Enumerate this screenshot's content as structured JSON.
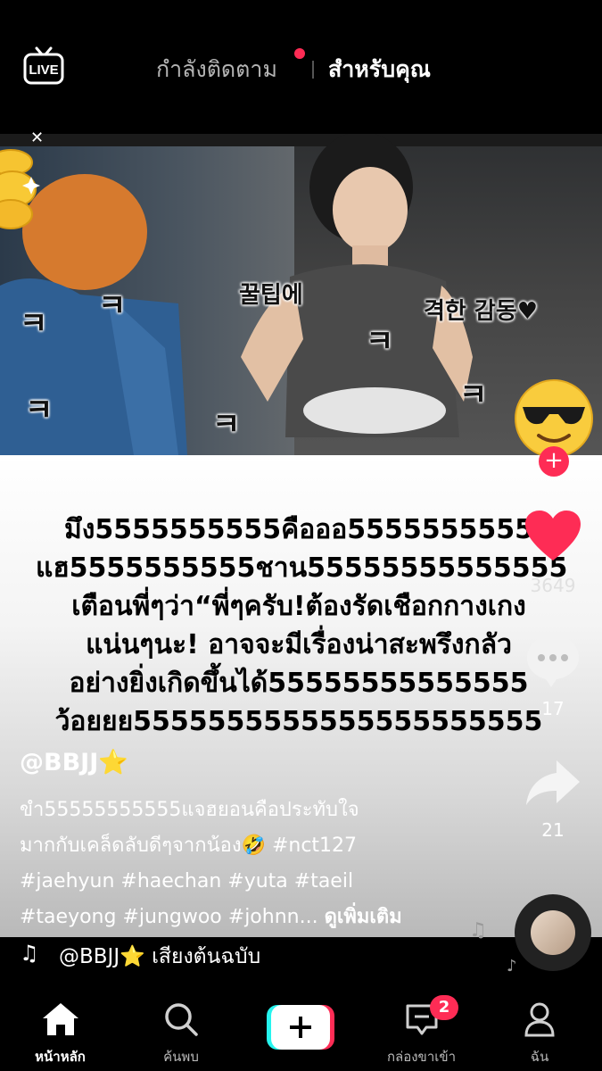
{
  "header": {
    "live_label": "LIVE",
    "tab_following": "กำลังติดตาม",
    "tab_for_you": "สำหรับคุณ"
  },
  "video": {
    "korean_caption_1": "꿀팁에",
    "korean_caption_2": "격한 감동♥",
    "sticker_glyph": "ㅋ",
    "overlay_text_lines": [
      "มึง5555555555คือออ5555555555",
      "แฮ5555555555ชาน55555555555555",
      "เตือนพี่ๆว่า“พี่ๆครับ!ต้องรัดเชือกกางเกง",
      "แน่นๆนะ! อาจจะมีเรื่องน่าสะพรึงกลัว",
      "อย่างยิ่งเกิดขึ้นได้55555555555555",
      "ว้อยยย5555555555555555555555"
    ]
  },
  "post": {
    "username": "@BBJJ⭐",
    "description_lines": [
      "ขำ55555555555แจฮยอนคือประทับใจ",
      "มากกับเคล็ดลับดีๆจากน้อง🤣 #nct127",
      "#jaehyun #haechan #yuta #taeil",
      "#taeyong #jungwoo #johnn..."
    ],
    "see_more": "ดูเพิ่มเติม",
    "sound": "@BBJJ⭐ เสียงต้นฉบับ"
  },
  "actions": {
    "likes": "3649",
    "comments": "17",
    "shares": "21"
  },
  "nav": {
    "home": "หน้าหลัก",
    "discover": "ค้นพบ",
    "inbox": "กล่องขาเข้า",
    "inbox_badge": "2",
    "me": "ฉัน"
  },
  "colors": {
    "accent": "#fe2c55",
    "background": "#000000",
    "plus_left": "#25f4ee",
    "plus_right": "#fe2c55"
  }
}
